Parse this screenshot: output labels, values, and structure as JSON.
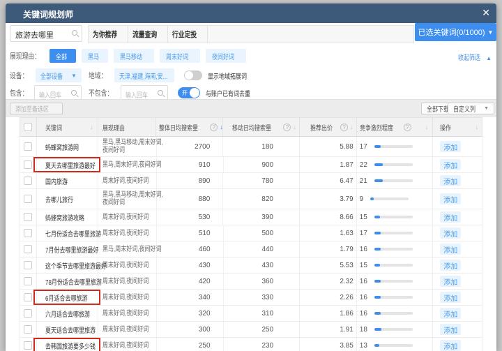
{
  "colors": {
    "accent": "#3e8ef0",
    "titlebar": "#3d5a7a",
    "highlight": "#cf2a1d",
    "chip_bg": "#e9f4fe"
  },
  "window": {
    "title": "关键词规划师"
  },
  "topbar": {
    "search_value": "旅游去哪里",
    "tabs": [
      "为你推荐",
      "流量查询",
      "行业定投"
    ],
    "selected_keywords_button": "已选关键词(0/1000)"
  },
  "filters": {
    "reason_label": "展现理由：",
    "reason_chips": [
      {
        "label": "全部",
        "active": true
      },
      {
        "label": "黑马",
        "active": false
      },
      {
        "label": "黑马移动",
        "active": false
      },
      {
        "label": "周末好词",
        "active": false
      },
      {
        "label": "夜间好词",
        "active": false
      }
    ],
    "collapse_link": "收起筛选",
    "device_label": "设备：",
    "device_value": "全部设备",
    "region_label": "地域：",
    "region_value": "天津,福建,海南,安...",
    "region_toggle_label": "显示地域拓展词",
    "include_label": "包含：",
    "include_placeholder": "输入回车",
    "exclude_label": "不包含：",
    "exclude_placeholder": "输入回车",
    "dedupe_state": "开",
    "dedupe_label": "与账户已有词去重"
  },
  "toolbar": {
    "add_to_candidates": "添加至备选区",
    "download_all": "全部下载",
    "custom_columns": "自定义列"
  },
  "table": {
    "headers": {
      "keyword": "关键词",
      "reason": "展现理由",
      "overall": "整体日均搜索量",
      "mobile": "移动日均搜索量",
      "bid": "推荐出价",
      "competition": "竞争激烈程度",
      "action": "操作"
    },
    "action_label": "添加",
    "rows": [
      {
        "keyword": "蚂蜂窝旅游网",
        "reason_lines": [
          "黑马,黑马移动,周末好词,",
          "夜间好词"
        ],
        "tall": true,
        "highlighted": false,
        "overall": "2700",
        "mobile": "180",
        "bid": "5.88",
        "competition": 17
      },
      {
        "keyword": "夏天去哪里旅游最好",
        "reason_lines": [
          "黑马,周末好词,夜间好词"
        ],
        "tall": false,
        "highlighted": true,
        "overall": "910",
        "mobile": "900",
        "bid": "1.87",
        "competition": 22
      },
      {
        "keyword": "国内旅游",
        "reason_lines": [
          "周末好词,夜间好词"
        ],
        "tall": false,
        "highlighted": false,
        "overall": "890",
        "mobile": "780",
        "bid": "6.47",
        "competition": 21
      },
      {
        "keyword": "去哪儿旅行",
        "reason_lines": [
          "黑马,黑马移动,周末好词,",
          "夜间好词"
        ],
        "tall": true,
        "highlighted": false,
        "overall": "880",
        "mobile": "820",
        "bid": "3.79",
        "competition": 9
      },
      {
        "keyword": "蚂蜂窝旅游攻略",
        "reason_lines": [
          "周末好词,夜间好词"
        ],
        "tall": false,
        "highlighted": false,
        "overall": "530",
        "mobile": "390",
        "bid": "8.66",
        "competition": 15
      },
      {
        "keyword": "七月份适合去哪里旅游",
        "reason_lines": [
          "周末好词,夜间好词"
        ],
        "tall": false,
        "highlighted": false,
        "overall": "510",
        "mobile": "500",
        "bid": "1.63",
        "competition": 17
      },
      {
        "keyword": "7月份去哪里旅游最好",
        "reason_lines": [
          "黑马,周末好词,夜间好词"
        ],
        "tall": false,
        "highlighted": false,
        "overall": "460",
        "mobile": "440",
        "bid": "1.79",
        "competition": 16
      },
      {
        "keyword": "这个季节去哪里旅游最好",
        "reason_lines": [
          "周末好词,夜间好词"
        ],
        "tall": false,
        "highlighted": false,
        "overall": "430",
        "mobile": "430",
        "bid": "5.53",
        "competition": 15
      },
      {
        "keyword": "78月份适合去哪里旅游",
        "reason_lines": [
          "周末好词,夜间好词"
        ],
        "tall": false,
        "highlighted": false,
        "overall": "420",
        "mobile": "360",
        "bid": "2.32",
        "competition": 16
      },
      {
        "keyword": "6月适合去哪旅游",
        "reason_lines": [
          "周末好词,夜间好词"
        ],
        "tall": false,
        "highlighted": true,
        "overall": "340",
        "mobile": "330",
        "bid": "2.26",
        "competition": 16
      },
      {
        "keyword": "六月适合去哪旅游",
        "reason_lines": [
          "周末好词,夜间好词"
        ],
        "tall": false,
        "highlighted": false,
        "overall": "320",
        "mobile": "310",
        "bid": "1.86",
        "competition": 16
      },
      {
        "keyword": "夏天适合去哪里旅游",
        "reason_lines": [
          "周末好词,夜间好词"
        ],
        "tall": false,
        "highlighted": false,
        "overall": "300",
        "mobile": "250",
        "bid": "1.91",
        "competition": 18
      },
      {
        "keyword": "去韩国旅游要多少钱",
        "reason_lines": [
          "周末好词,夜间好词"
        ],
        "tall": false,
        "highlighted": true,
        "overall": "250",
        "mobile": "230",
        "bid": "3.85",
        "competition": 13
      }
    ]
  }
}
